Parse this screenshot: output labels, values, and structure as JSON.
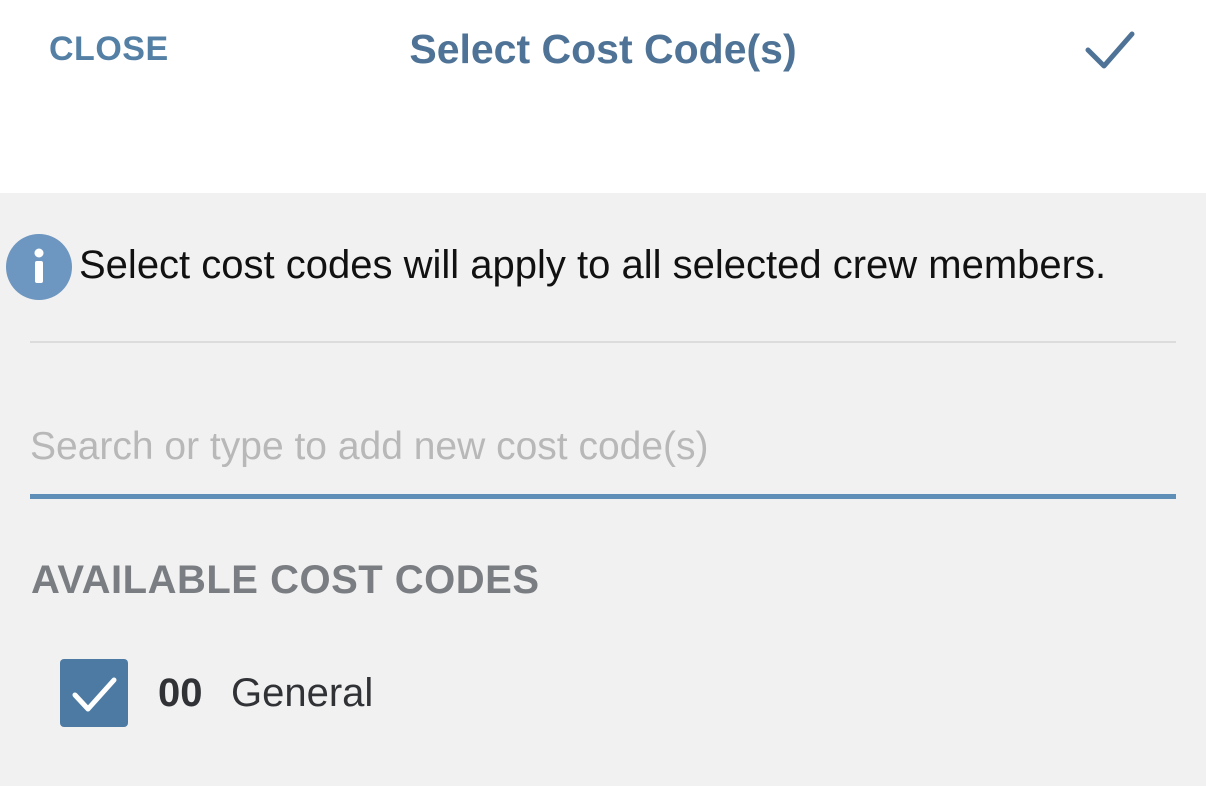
{
  "header": {
    "close_label": "CLOSE",
    "title": "Select Cost Code(s)",
    "confirm_icon": "checkmark-icon"
  },
  "info": {
    "icon": "info-icon",
    "icon_glyph": "i",
    "message": "Select cost codes will apply to all selected crew members."
  },
  "search": {
    "placeholder": "Search or type to add new cost code(s)",
    "value": ""
  },
  "available": {
    "heading": "AVAILABLE COST CODES",
    "items": [
      {
        "code": "00",
        "name": "General",
        "checked": true
      }
    ]
  },
  "colors": {
    "accent": "#5580a6",
    "title": "#4e7396",
    "info_icon": "#6d96c0",
    "underline": "#5f8fb7",
    "checkbox": "#4d7aa2",
    "background": "#f1f1f1"
  }
}
